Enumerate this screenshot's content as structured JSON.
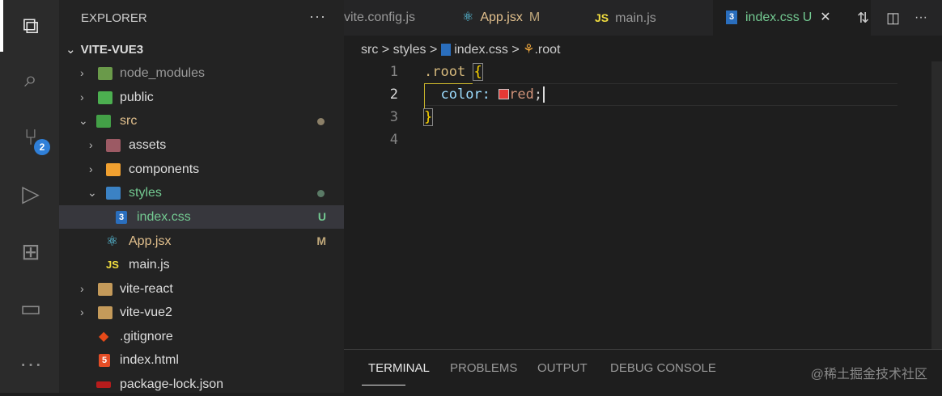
{
  "activity_bar": {
    "scm_badge": "2"
  },
  "sidebar": {
    "title": "EXPLORER",
    "more": "···",
    "root": "VITE-VUE3",
    "items": [
      {
        "label": "node_modules",
        "status": ""
      },
      {
        "label": "public",
        "status": ""
      },
      {
        "label": "src",
        "status": ""
      },
      {
        "label": "assets",
        "status": ""
      },
      {
        "label": "components",
        "status": ""
      },
      {
        "label": "styles",
        "status": ""
      },
      {
        "label": "index.css",
        "status": "U"
      },
      {
        "label": "App.jsx",
        "status": "M"
      },
      {
        "label": "main.js",
        "status": ""
      },
      {
        "label": "vite-react",
        "status": ""
      },
      {
        "label": "vite-vue2",
        "status": ""
      },
      {
        "label": ".gitignore",
        "status": ""
      },
      {
        "label": "index.html",
        "status": ""
      },
      {
        "label": "package-lock.json",
        "status": ""
      }
    ]
  },
  "tabs": [
    {
      "label": "vite.config.js",
      "status": ""
    },
    {
      "label": "App.jsx",
      "status": "M"
    },
    {
      "label": "main.js",
      "status": "",
      "icon": "JS"
    },
    {
      "label": "index.css",
      "status": "U",
      "close": "✕"
    }
  ],
  "breadcrumb": {
    "parts": [
      "src",
      "styles",
      "index.css",
      ".root"
    ],
    "sep": ">"
  },
  "editor": {
    "line_numbers": [
      "1",
      "2",
      "3",
      "4"
    ],
    "line1": {
      "selector": ".root",
      "brace": "{"
    },
    "line2": {
      "prop": "color:",
      "value": "red",
      "semi": ";"
    },
    "line3": {
      "brace": "}"
    }
  },
  "panel": {
    "tabs": [
      "TERMINAL",
      "PROBLEMS",
      "OUTPUT",
      "DEBUG CONSOLE"
    ],
    "watermark": "@稀土掘金技术社区"
  },
  "colors": {
    "accent": "#2f7fd8",
    "untracked": "#73c991",
    "modified": "#e2c08d",
    "swatch": "#e53935"
  }
}
